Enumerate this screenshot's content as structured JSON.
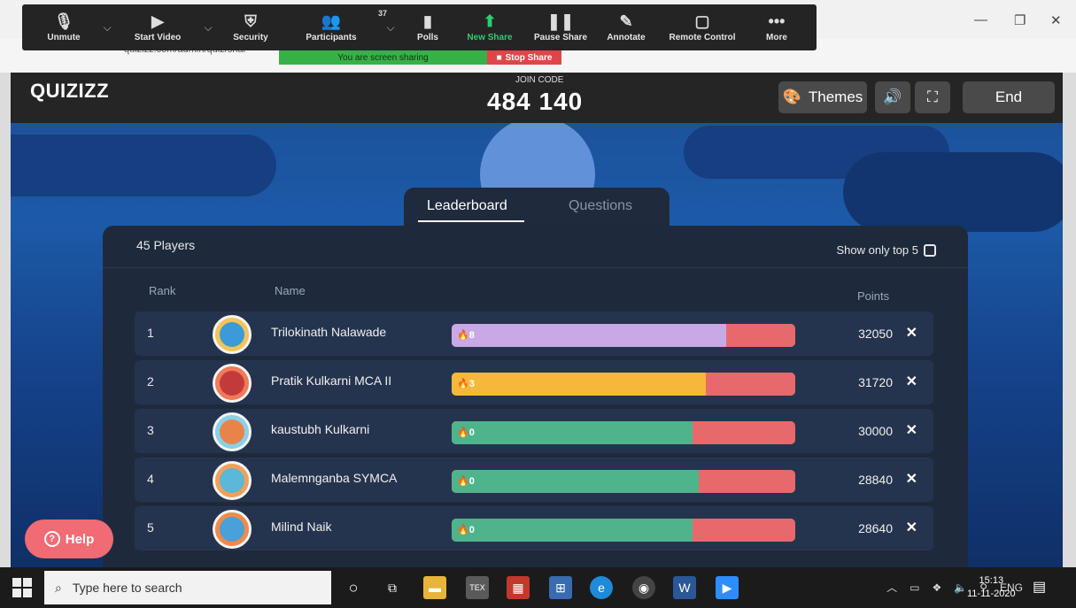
{
  "zoom": {
    "items": [
      {
        "name": "unmute",
        "label": "Unmute",
        "icon": "mic-muted-icon"
      },
      {
        "name": "start-video",
        "label": "Start Video",
        "icon": "video-off-icon"
      },
      {
        "name": "security",
        "label": "Security",
        "icon": "shield-icon"
      },
      {
        "name": "participants",
        "label": "Participants",
        "icon": "people-icon"
      },
      {
        "name": "polls",
        "label": "Polls",
        "icon": "bar-chart-icon"
      },
      {
        "name": "new-share",
        "label": "New Share",
        "icon": "share-up-icon"
      },
      {
        "name": "pause-share",
        "label": "Pause Share",
        "icon": "pause-icon"
      },
      {
        "name": "annotate",
        "label": "Annotate",
        "icon": "pencil-icon"
      },
      {
        "name": "remote-control",
        "label": "Remote Control",
        "icon": "mouse-icon"
      },
      {
        "name": "more",
        "label": "More",
        "icon": "ellipsis-icon"
      }
    ],
    "participants_count": "37",
    "sharing_text": "You are screen sharing",
    "stop_share": "Stop Share"
  },
  "browser": {
    "url": "quizizz.com/admin/quiz/shar"
  },
  "app": {
    "logo": "QUIZIZZ",
    "join_label": "JOIN CODE",
    "join_code": "484 140",
    "themes": "Themes",
    "end": "End"
  },
  "tabs": {
    "leaderboard": "Leaderboard",
    "questions": "Questions"
  },
  "leaderboard": {
    "players": "45 Players",
    "show_top": "Show only top 5",
    "col_rank": "Rank",
    "col_name": "Name",
    "col_points": "Points",
    "rows": [
      {
        "rank": "1",
        "name": "Trilokinath Nalawade",
        "streak": "8",
        "correct_fraction": 0.8,
        "bar_color": "#c9a8e6",
        "points": "32050",
        "avatar_color": "#f4c45a",
        "avatar_inner": "#3b9ad9"
      },
      {
        "rank": "2",
        "name": "Pratik Kulkarni MCA II",
        "streak": "3",
        "correct_fraction": 0.74,
        "bar_color": "#f4b83a",
        "points": "31720",
        "avatar_color": "#f07a5a",
        "avatar_inner": "#c23a3a"
      },
      {
        "rank": "3",
        "name": "kaustubh Kulkarni",
        "streak": "0",
        "correct_fraction": 0.7,
        "bar_color": "#4fb48c",
        "points": "30000",
        "avatar_color": "#8ad0e8",
        "avatar_inner": "#e8844a"
      },
      {
        "rank": "4",
        "name": "Malemnganba SYMCA",
        "streak": "0",
        "correct_fraction": 0.72,
        "bar_color": "#4fb48c",
        "points": "28840",
        "avatar_color": "#f0a05a",
        "avatar_inner": "#5ab8d8"
      },
      {
        "rank": "5",
        "name": "Milind Naik",
        "streak": "0",
        "correct_fraction": 0.7,
        "bar_color": "#4fb48c",
        "points": "28640",
        "avatar_color": "#f08a4a",
        "avatar_inner": "#4aa0d8"
      }
    ]
  },
  "help": "Help",
  "taskbar": {
    "search_placeholder": "Type here to search",
    "lang": "ENG",
    "time": "15:13",
    "date": "11-11-2020",
    "notif_count": "3"
  }
}
